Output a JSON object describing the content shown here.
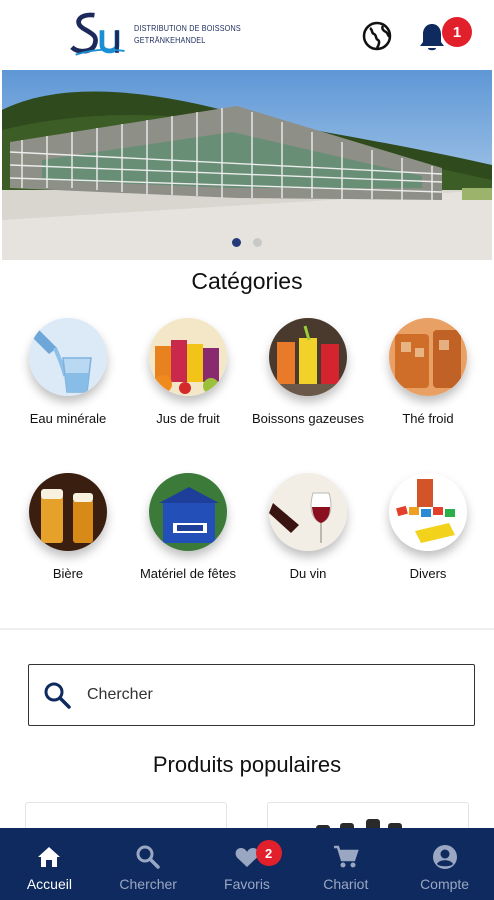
{
  "header": {
    "logo_letters": "Su",
    "logo_line1": "DISTRIBUTION DE BOISSONS",
    "logo_line2": "GETRÄNKEHANDEL",
    "notification_count": "1",
    "icons": [
      "globe-icon",
      "bell-icon"
    ]
  },
  "hero": {
    "slide_count": 2,
    "active_slide": 0
  },
  "categories": {
    "title": "Catégories",
    "items": [
      {
        "label": "Eau minérale",
        "icon": "water-icon"
      },
      {
        "label": "Jus de fruit",
        "icon": "juice-icon"
      },
      {
        "label": "Boissons gazeuses",
        "icon": "soda-icon"
      },
      {
        "label": "Thé froid",
        "icon": "iced-tea-icon"
      },
      {
        "label": "Bière",
        "icon": "beer-icon"
      },
      {
        "label": "Matériel de fêtes",
        "icon": "party-tent-icon"
      },
      {
        "label": "Du vin",
        "icon": "wine-icon"
      },
      {
        "label": "Divers",
        "icon": "misc-icon"
      }
    ]
  },
  "search": {
    "placeholder": "Chercher"
  },
  "popular": {
    "title": "Produits populaires"
  },
  "bottom_nav": {
    "items": [
      {
        "label": "Accueil",
        "icon": "home-icon",
        "active": true
      },
      {
        "label": "Chercher",
        "icon": "search-icon",
        "active": false
      },
      {
        "label": "Favoris",
        "icon": "heart-icon",
        "active": false,
        "badge": "2"
      },
      {
        "label": "Chariot",
        "icon": "cart-icon",
        "active": false
      },
      {
        "label": "Compte",
        "icon": "account-icon",
        "active": false
      }
    ]
  },
  "colors": {
    "brand_navy": "#0f2a5e",
    "badge_red": "#e2202b",
    "dot_active": "#243a7a"
  }
}
